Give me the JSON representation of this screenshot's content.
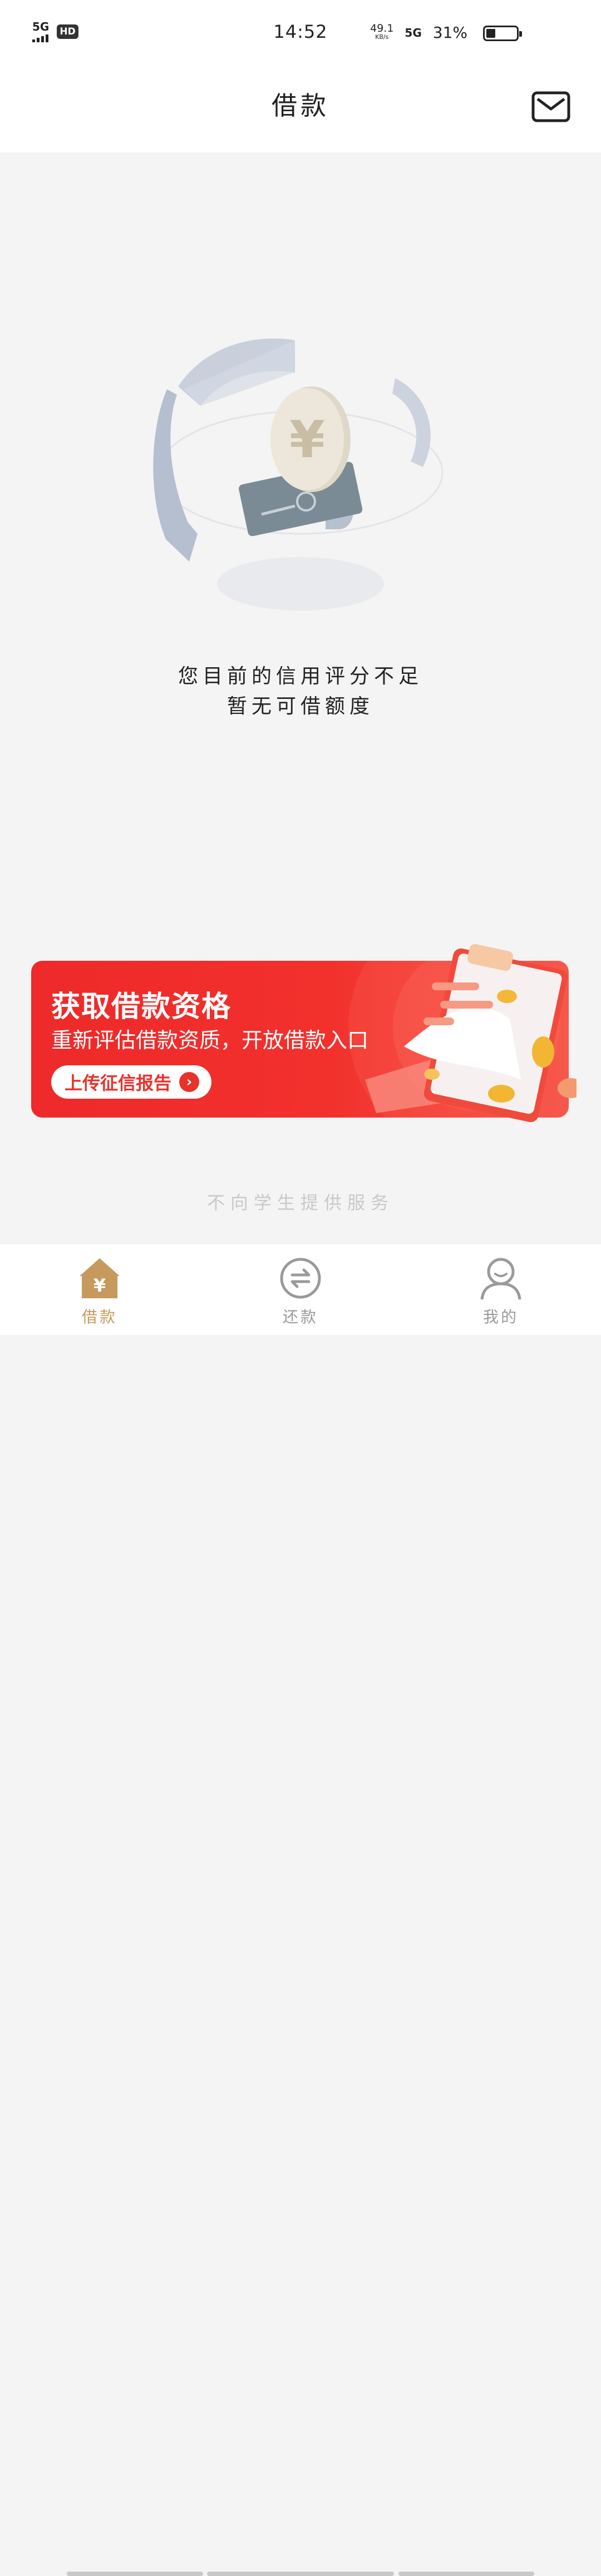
{
  "status_bar": {
    "network_left": "5G",
    "hd": "HD",
    "time": "14:52",
    "speed_value": "49.1",
    "speed_unit": "KB/s",
    "network_right": "5G",
    "battery_percent": "31%",
    "battery_level": 0.31
  },
  "header": {
    "title": "借款",
    "mail_icon": "mail-icon"
  },
  "empty_state": {
    "line1": "您目前的信用评分不足",
    "line2": "暂无可借额度"
  },
  "banner": {
    "title": "获取借款资格",
    "subtitle": "重新评估借款资质，开放借款入口",
    "button_label": "上传征信报告"
  },
  "footer_note": "不向学生提供服务",
  "tabs": [
    {
      "label": "借款",
      "icon": "home-yuan-icon",
      "active": true
    },
    {
      "label": "还款",
      "icon": "repay-icon",
      "active": false
    },
    {
      "label": "我的",
      "icon": "user-icon",
      "active": false
    }
  ],
  "colors": {
    "accent_gold": "#c69a5c",
    "banner_red": "#ee2a2a",
    "background": "#f4f4f4"
  }
}
